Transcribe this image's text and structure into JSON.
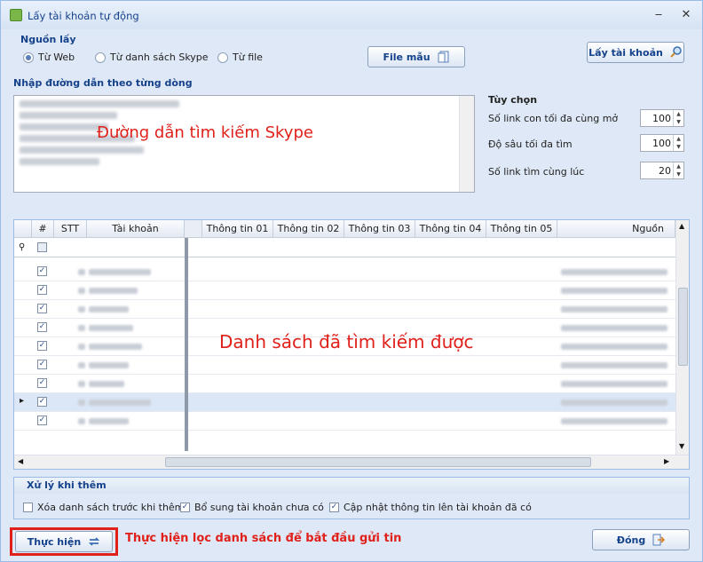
{
  "window": {
    "title": "Lấy tài khoản tự động"
  },
  "source": {
    "label": "Nguồn lấy",
    "options": [
      "Từ Web",
      "Từ danh sách Skype",
      "Từ file"
    ],
    "selected": "Từ Web"
  },
  "buttons": {
    "sample_file": "File mẫu",
    "get_accounts": "Lấy tài khoản",
    "execute": "Thực hiện",
    "close": "Đóng"
  },
  "input": {
    "label": "Nhập đường dẫn theo từng dòng",
    "overlay_note": "Đường dẫn tìm kiếm Skype"
  },
  "options": {
    "title": "Tùy chọn",
    "items": [
      {
        "label": "Số link con tối đa cùng mở",
        "value": "100"
      },
      {
        "label": "Độ sâu tối đa tìm",
        "value": "100"
      },
      {
        "label": "Số link tìm cùng lúc",
        "value": "20"
      }
    ]
  },
  "grid": {
    "columns": [
      "#",
      "STT",
      "Tài khoản",
      "Thông tin 01",
      "Thông tin 02",
      "Thông tin 03",
      "Thông tin 04",
      "Thông tin 05",
      "Nguồn"
    ],
    "overlay_note": "Danh sách đã tìm kiếm được",
    "row_count_visible": 9,
    "current_row_index": 7
  },
  "post_process": {
    "title": "Xử lý khi thêm",
    "checks": [
      {
        "label": "Xóa danh sách trước khi thêm",
        "checked": false
      },
      {
        "label": "Bổ sung tài khoản chưa có",
        "checked": true
      },
      {
        "label": "Cập nhật thông tin lên tài khoản đã có",
        "checked": true
      }
    ]
  },
  "footer_note": "Thực hiện lọc danh sách để bắt đầu gửi tin",
  "colors": {
    "annotation": "#e0201a",
    "accent": "#15428b"
  }
}
